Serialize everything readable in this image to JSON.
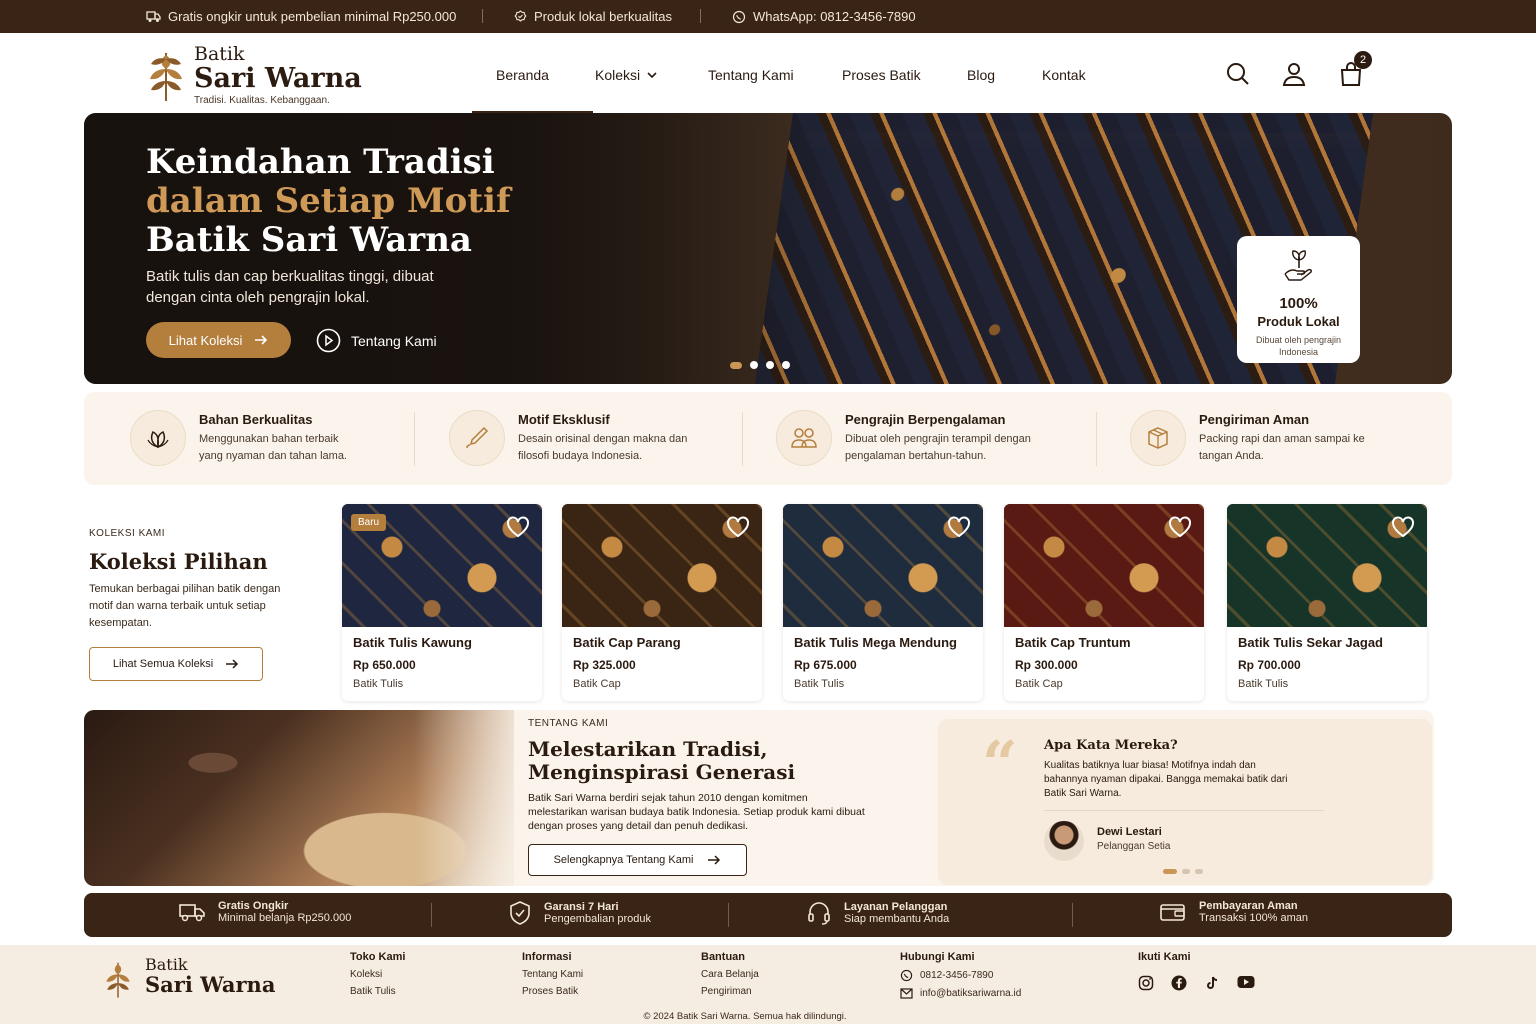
{
  "topbar": {
    "shipping": "Gratis ongkir untuk pembelian minimal Rp250.000",
    "local": "Produk lokal berkualitas",
    "whatsapp": "WhatsApp: 0812-3456-7890"
  },
  "brand": {
    "line1": "Batik",
    "line2": "Sari Warna",
    "tagline": "Tradisi. Kualitas. Kebanggaan."
  },
  "nav": {
    "items": [
      "Beranda",
      "Koleksi",
      "Tentang Kami",
      "Proses Batik",
      "Blog",
      "Kontak"
    ],
    "cart_count": "2"
  },
  "hero": {
    "title1": "Keindahan Tradisi",
    "title2": "dalam Setiap Motif",
    "title3": "Batik Sari Warna",
    "subtitle": "Batik tulis dan cap berkualitas tinggi, dibuat dengan cinta oleh pengrajin lokal.",
    "primary_btn": "Lihat Koleksi",
    "secondary_btn": "Tentang Kami",
    "badge_pct": "100%",
    "badge_label": "Produk Lokal",
    "badge_desc": "Dibuat oleh pengrajin Indonesia"
  },
  "features": [
    {
      "title": "Bahan Berkualitas",
      "desc": "Menggunakan bahan terbaik yang nyaman dan tahan lama.",
      "icon": "leaf-icon"
    },
    {
      "title": "Motif Eksklusif",
      "desc": "Desain orisinal dengan makna dan filosofi budaya Indonesia.",
      "icon": "brush-icon"
    },
    {
      "title": "Pengrajin Berpengalaman",
      "desc": "Dibuat oleh pengrajin terampil dengan pengalaman bertahun-tahun.",
      "icon": "people-icon"
    },
    {
      "title": "Pengiriman Aman",
      "desc": "Packing rapi dan aman sampai ke tangan Anda.",
      "icon": "box-icon"
    }
  ],
  "collection": {
    "kicker": "KOLEKSI KAMI",
    "title": "Koleksi Pilihan",
    "desc": "Temukan berbagai pilihan batik dengan motif dan warna terbaik untuk setiap kesempatan.",
    "button": "Lihat Semua Koleksi",
    "products": [
      {
        "name": "Batik Tulis Kawung",
        "price": "Rp 650.000",
        "category": "Batik Tulis",
        "tag": "Baru",
        "color": "#1f2740"
      },
      {
        "name": "Batik Cap Parang",
        "price": "Rp 325.000",
        "category": "Batik Cap",
        "tag": "",
        "color": "#3a2414"
      },
      {
        "name": "Batik Tulis Mega Mendung",
        "price": "Rp 675.000",
        "category": "Batik Tulis",
        "tag": "",
        "color": "#1e2c3e"
      },
      {
        "name": "Batik Cap Truntum",
        "price": "Rp 300.000",
        "category": "Batik Cap",
        "tag": "",
        "color": "#5a1a14"
      },
      {
        "name": "Batik Tulis Sekar Jagad",
        "price": "Rp 700.000",
        "category": "Batik Tulis",
        "tag": "",
        "color": "#173428"
      }
    ]
  },
  "about": {
    "kicker": "TENTANG KAMI",
    "title1": "Melestarikan Tradisi,",
    "title2": "Menginspirasi Generasi",
    "desc": "Batik Sari Warna berdiri sejak tahun 2010 dengan komitmen melestarikan warisan budaya batik Indonesia. Setiap produk kami dibuat dengan proses yang detail dan penuh dedikasi.",
    "button": "Selengkapnya Tentang Kami"
  },
  "testimonial": {
    "quote_mark": "“",
    "title": "Apa Kata Mereka?",
    "text": "Kualitas batiknya luar biasa! Motifnya indah dan bahannya nyaman dipakai. Bangga memakai batik dari Batik Sari Warna.",
    "name": "Dewi Lestari",
    "role": "Pelanggan Setia"
  },
  "services": [
    {
      "title": "Gratis Ongkir",
      "desc": "Minimal belanja Rp250.000",
      "icon": "truck-icon"
    },
    {
      "title": "Garansi 7 Hari",
      "desc": "Pengembalian produk",
      "icon": "shield-icon"
    },
    {
      "title": "Layanan Pelanggan",
      "desc": "Siap membantu Anda",
      "icon": "headset-icon"
    },
    {
      "title": "Pembayaran Aman",
      "desc": "Transaksi 100% aman",
      "icon": "wallet-icon"
    }
  ],
  "footer": {
    "col1": {
      "heading": "Toko Kami",
      "links": [
        "Koleksi",
        "Batik Tulis"
      ]
    },
    "col2": {
      "heading": "Informasi",
      "links": [
        "Tentang Kami",
        "Proses Batik"
      ]
    },
    "col3": {
      "heading": "Bantuan",
      "links": [
        "Cara Belanja",
        "Pengiriman"
      ]
    },
    "col4": {
      "heading": "Hubungi Kami",
      "phone": "0812-3456-7890",
      "email": "info@batiksariwarna.id"
    },
    "col5": {
      "heading": "Ikuti Kami"
    },
    "copyright": "© 2024 Batik Sari Warna. Semua hak dilindungi."
  },
  "colors": {
    "brown": "#3a2416",
    "gold": "#b47e3c",
    "cream": "#faf4ec"
  }
}
